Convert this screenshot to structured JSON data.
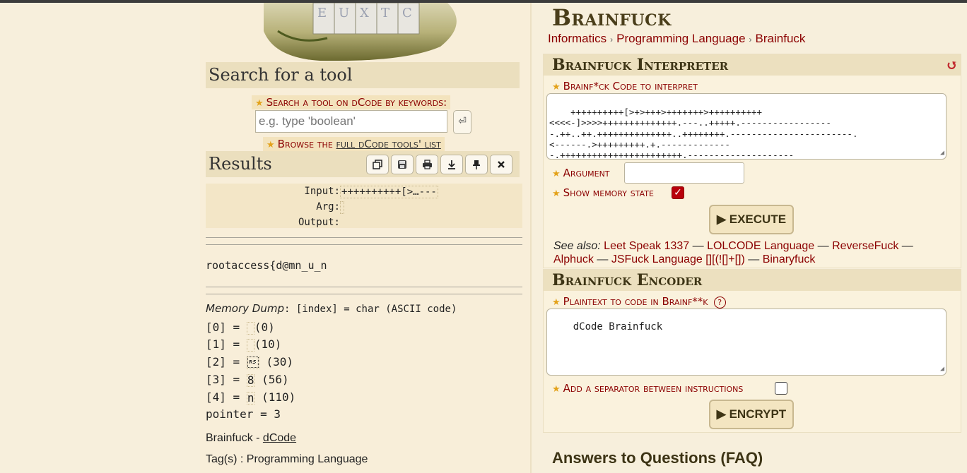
{
  "search": {
    "heading": "Search for a tool",
    "keywords_label": "Search a tool on dCode by keywords:",
    "input_placeholder": "e.g. type 'boolean'",
    "enter_symbol": "⏎",
    "browse_prefix": "Browse the ",
    "browse_link": "full dCode tools' list"
  },
  "results": {
    "heading": "Results",
    "toolbar_icons": [
      "copy-icon",
      "save-icon",
      "print-icon",
      "download-icon",
      "pin-icon",
      "close-icon"
    ],
    "input_label": "Input:",
    "input_value": "++++++++++[>…---",
    "arg_label": "Arg:",
    "arg_value": "",
    "output_label": "Output:",
    "output_text": "rootaccess{d@mn_u_n",
    "memory_dump_title": "Memory Dump",
    "memory_dump_legend": ": [index] = char (ASCII code)",
    "memory": [
      {
        "index": "[0]",
        "char": "",
        "code": "(0)"
      },
      {
        "index": "[1]",
        "char": "",
        "code": "(10)"
      },
      {
        "index": "[2]",
        "char": "\u001e",
        "code": "(30)"
      },
      {
        "index": "[3]",
        "char": "8",
        "code": "(56)"
      },
      {
        "index": "[4]",
        "char": "n",
        "code": "(110)"
      }
    ],
    "pointer_text": "pointer = 3",
    "credit_prefix": "Brainfuck - ",
    "credit_link": "dCode",
    "tags_text": "Tag(s) : Programming Language"
  },
  "page": {
    "title": "Brainfuck",
    "breadcrumb": [
      "Informatics",
      "Programming Language",
      "Brainfuck"
    ],
    "breadcrumb_sep": "›"
  },
  "interpreter": {
    "heading": "Brainfuck Interpreter",
    "reset_symbol": "↺",
    "code_label": "Brainf*ck Code to interpret",
    "code_value": "++++++++++[>+>+++>+++++++>++++++++++\n<<<<-]>>>>++++++++++++++.---..+++++.-----------------\n-.++..++.++++++++++++++..++++++++.-----------------------.\n<------.>+++++++++.+.-------------\n-.+++++++++++++++++++++++.--------------------\n-.+++++++++++++++.<--------",
    "argument_label": "Argument",
    "argument_value": "",
    "show_memory_label": "Show memory state",
    "show_memory_checked": true,
    "execute_label": "▶ EXECUTE",
    "see_also_label": "See also:",
    "see_also": [
      "Leet Speak 1337",
      "LOLCODE Language",
      "ReverseFuck",
      "Alphuck",
      "JSFuck Language [][(![]+[])",
      "Binaryfuck"
    ],
    "see_also_sep": " — "
  },
  "encoder": {
    "heading": "Brainfuck Encoder",
    "plaintext_label": "Plaintext to code in Brainf**k",
    "help_symbol": "?",
    "plaintext_value": "dCode Brainfuck",
    "separator_label": "Add a separator between instructions",
    "separator_checked": false,
    "encrypt_label": "▶ ENCRYPT"
  },
  "faq": {
    "heading": "Answers to Questions (FAQ)"
  },
  "colors": {
    "accent_red": "#8b0000",
    "panel_header": "#ece0bf",
    "background": "#f7efdc",
    "star": "#e3a21a"
  }
}
